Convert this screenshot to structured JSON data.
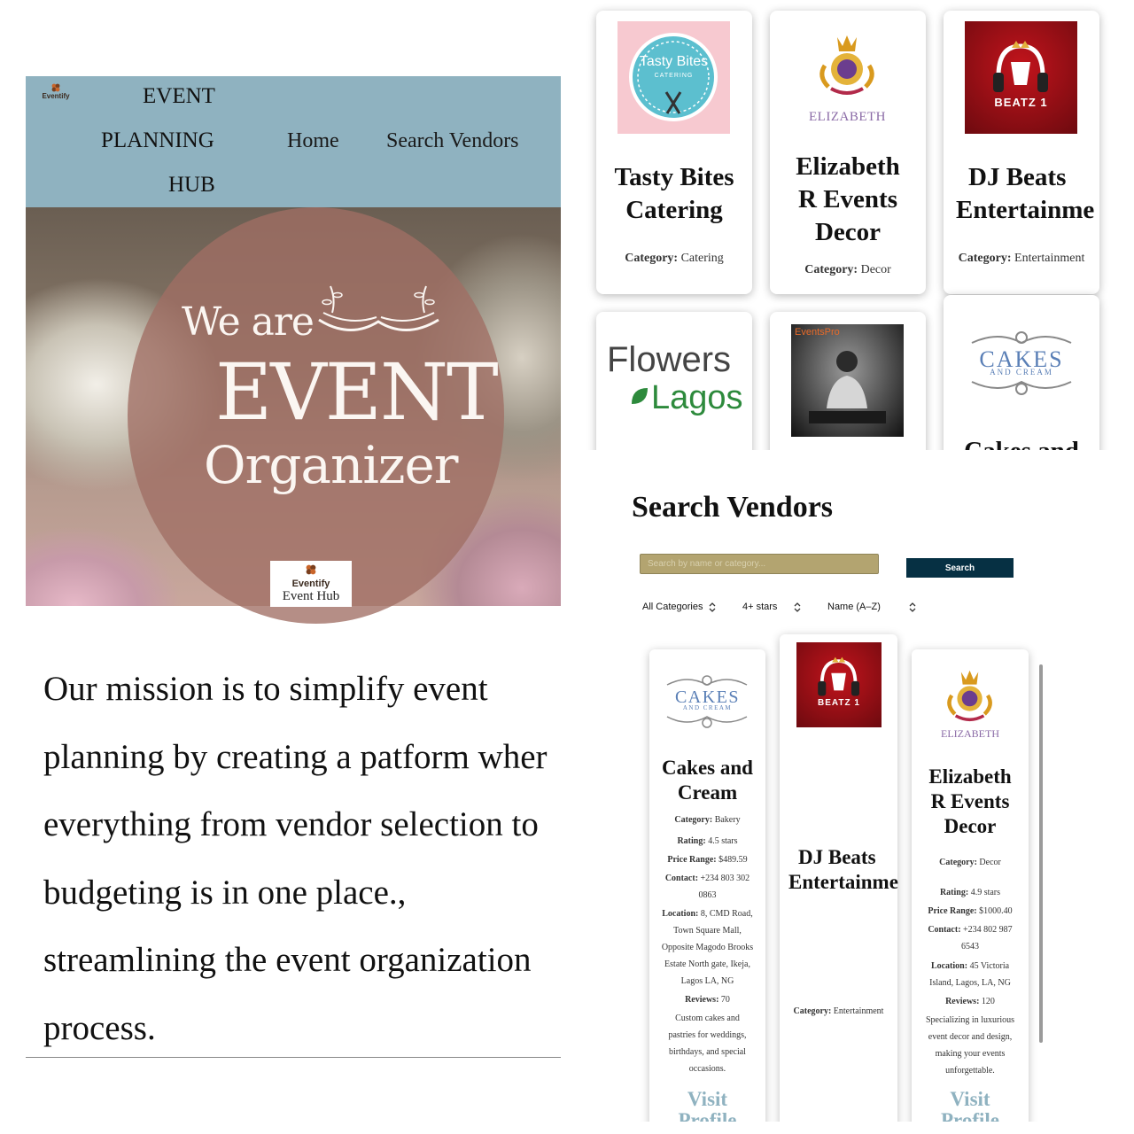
{
  "brand": {
    "logo_text": "Eventify"
  },
  "header": {
    "title_lines": [
      "EVENT",
      "PLANNING",
      "HUB"
    ],
    "nav": {
      "home": "Home",
      "search_vendors": "Search Vendors"
    }
  },
  "hero": {
    "line1": "We are",
    "line2": "EVENT",
    "line3": "Organizer",
    "badge_brand": "Eventify",
    "badge_sub": "Event Hub"
  },
  "mission": {
    "lines": [
      "Our mission is to simplify event",
      "planning by creating a patform wher",
      "everything from vendor selection to",
      "budgeting is in one place.,",
      "streamlining the event organization",
      "process."
    ]
  },
  "grid_cards": [
    {
      "name_lines": [
        "Tasty Bites",
        "Catering"
      ],
      "category_label": "Category:",
      "category": "Catering",
      "logo": {
        "title": "Tasty Bites",
        "sub": "CATERING"
      }
    },
    {
      "name_lines": [
        "Elizabeth",
        "R Events",
        "Decor"
      ],
      "category_label": "Category:",
      "category": "Decor",
      "logo": {
        "title": "ELIZABETH"
      }
    },
    {
      "name_lines": [
        "DJ Beats",
        "Entertainme"
      ],
      "category_label": "Category:",
      "category": "Entertainment",
      "logo": {
        "title": "BEATZ 1"
      }
    },
    {
      "name_lines": [
        "Cakes and"
      ],
      "logo": {
        "title": "Flowers",
        "sub": "Lagos"
      }
    },
    {
      "name_lines": [
        ""
      ],
      "logo": {
        "title": "EventsPro"
      }
    },
    {
      "name_lines": [
        "Cakes and"
      ],
      "logo": {
        "title": "CAKES",
        "sub": "AND CREAM"
      }
    }
  ],
  "search": {
    "title": "Search Vendors",
    "placeholder": "Search by name or category...",
    "button": "Search",
    "filters": {
      "category": "All Categories",
      "rating": "4+ stars",
      "sort": "Name (A–Z)"
    }
  },
  "results": [
    {
      "logo": {
        "title": "CAKES",
        "sub": "AND CREAM"
      },
      "name_lines": [
        "Cakes and",
        "Cream"
      ],
      "category_label": "Category:",
      "category": "Bakery",
      "rating_label": "Rating:",
      "rating": "4.5 stars",
      "price_label": "Price Range:",
      "price": "$489.59",
      "contact_label": "Contact:",
      "contact_lines": [
        "+234 803 302",
        "0863"
      ],
      "location_label": "Location:",
      "location_lines": [
        "8, CMD Road,",
        "Town Square Mall,",
        "Opposite Magodo Brooks",
        "Estate North gate, Ikeja,",
        "Lagos LA, NG"
      ],
      "reviews_label": "Reviews:",
      "reviews": "70",
      "desc_lines": [
        "Custom cakes and",
        "pastries for weddings,",
        "birthdays, and special",
        "occasions."
      ],
      "visit_lines": [
        "Visit",
        "Profile"
      ]
    },
    {
      "logo": {
        "title": "BEATZ 1"
      },
      "name_lines": [
        "DJ Beats",
        "Entertainme"
      ],
      "category_label": "Category:",
      "category": "Entertainment"
    },
    {
      "logo": {
        "title": "ELIZABETH"
      },
      "name_lines": [
        "Elizabeth",
        "R Events",
        "Decor"
      ],
      "category_label": "Category:",
      "category": "Decor",
      "rating_label": "Rating:",
      "rating": "4.9 stars",
      "price_label": "Price Range:",
      "price": "$1000.40",
      "contact_label": "Contact:",
      "contact_lines": [
        "+234 802 987",
        "6543"
      ],
      "location_label": "Location:",
      "location_lines": [
        "45 Victoria",
        "Island, Lagos, LA, NG"
      ],
      "reviews_label": "Reviews:",
      "reviews": "120",
      "desc_lines": [
        "Specializing in luxurious",
        "event decor and design,",
        "making your events",
        "unforgettable."
      ],
      "visit_lines": [
        "Visit",
        "Profile"
      ]
    }
  ],
  "colors": {
    "header_bg": "#8fb2c0",
    "search_button": "#063043",
    "search_input": "#b3a470",
    "visit_link": "#8fb2c0"
  },
  "icons": {
    "sort_chevron": "chevron-up-down-icon"
  }
}
